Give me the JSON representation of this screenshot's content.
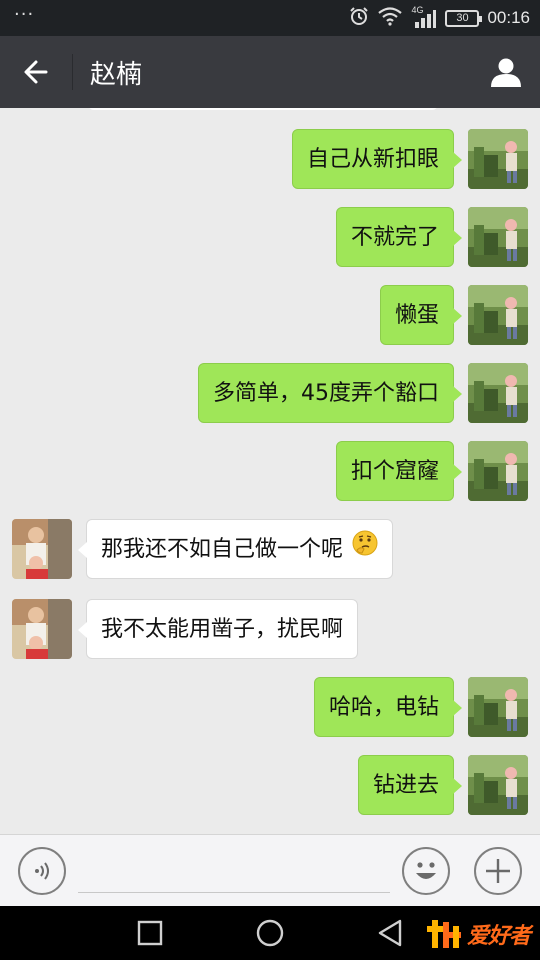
{
  "status_bar": {
    "network": "4G",
    "battery": "30",
    "time": "00:16"
  },
  "header": {
    "title": "赵楠"
  },
  "messages": [
    {
      "side": "mine",
      "text": "自己从新扣眼"
    },
    {
      "side": "mine",
      "text": "不就完了"
    },
    {
      "side": "mine",
      "text": "懒蛋"
    },
    {
      "side": "mine",
      "text": "多简单，45度弄个豁口"
    },
    {
      "side": "mine",
      "text": "扣个窟窿"
    },
    {
      "side": "theirs",
      "text": "那我还不如自己做一个呢",
      "emoji": "thinking-face"
    },
    {
      "side": "theirs",
      "text": "我不太能用凿子，扰民啊"
    },
    {
      "side": "mine",
      "text": "哈哈，电钻"
    },
    {
      "side": "mine",
      "text": "钻进去"
    }
  ],
  "input_bar": {
    "placeholder": "",
    "icons": [
      "voice-icon",
      "emoji-icon",
      "plus-icon"
    ]
  },
  "nav_bar": {
    "icons": [
      "recent-apps-icon",
      "home-icon",
      "back-icon"
    ],
    "watermark_text": "爱好者"
  },
  "colors": {
    "header_bg": "#393a3f",
    "status_bg": "#1f2225",
    "chat_bg": "#ebebeb",
    "mine_bubble": "#9fe658",
    "theirs_bubble": "#ffffff",
    "watermark": "#ff6a1a"
  }
}
